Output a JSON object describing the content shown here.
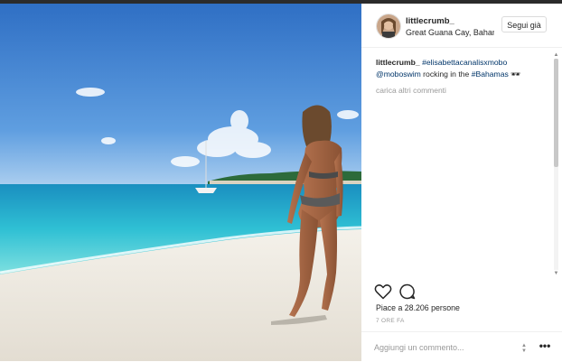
{
  "post": {
    "username": "littlecrumb_",
    "location": "Great Guana Cay, Bahamas",
    "follow_label": "Segui già",
    "caption": {
      "user": "littlecrumb_",
      "tag1": "#elisabettacanalisxmobo",
      "mention": "@moboswim",
      "text": " rocking in the ",
      "tag2": "#Bahamas",
      "emoji": "🕶"
    },
    "load_more": "carica altri commenti",
    "likes": "Piace a 28.206 persone",
    "time": "7 ORE FA",
    "comment_placeholder": "Aggiungi un commento...",
    "more_options": "•••"
  },
  "icons": {
    "like": "heart-icon",
    "comment": "comment-bubble-icon",
    "options": "more-options-icon",
    "spinner": "up-down-arrows-icon"
  },
  "colors": {
    "link": "#003569",
    "muted": "#999999",
    "text": "#262626"
  }
}
